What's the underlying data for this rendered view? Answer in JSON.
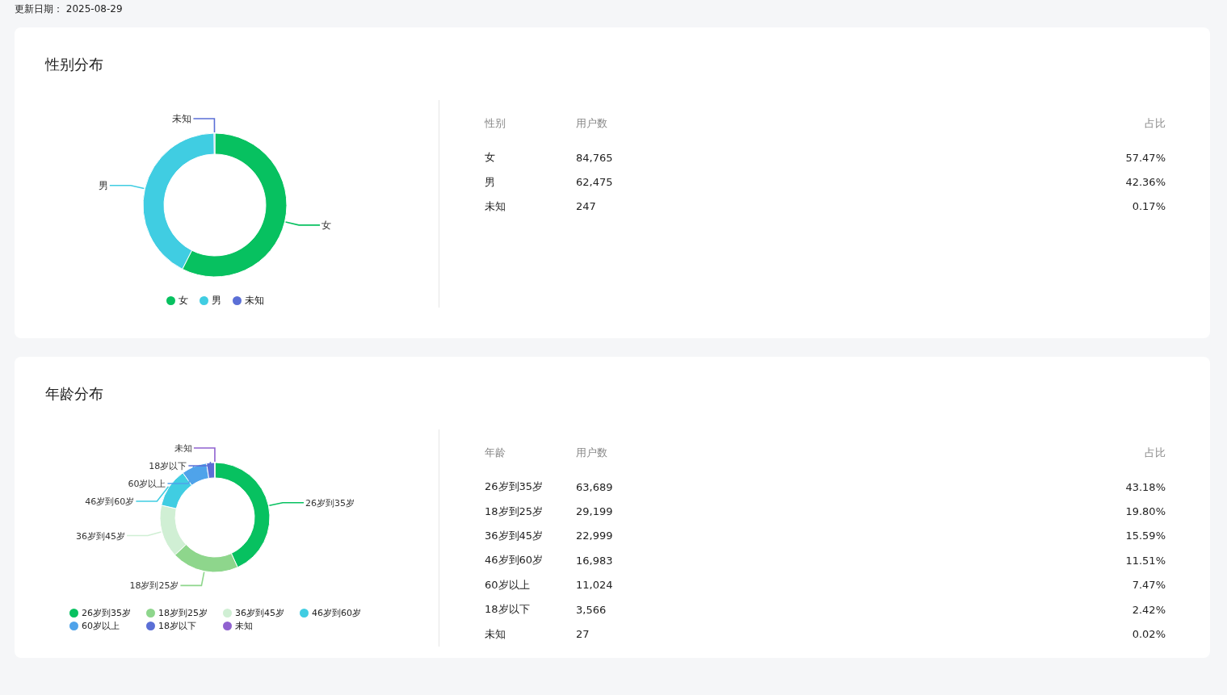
{
  "updated": "更新日期： 2025-08-29",
  "sections": [
    {
      "title": "性别分布",
      "kind": "center",
      "chart_data": {
        "type": "donut",
        "categories": [
          "女",
          "男",
          "未知"
        ],
        "values": [
          57.47,
          42.36,
          0.17
        ],
        "colors": [
          "#07c160",
          "#40cde2",
          "#5b6fd6"
        ]
      },
      "legend": [
        {
          "label": "女",
          "color": "#07c160"
        },
        {
          "label": "男",
          "color": "#40cde2"
        },
        {
          "label": "未知",
          "color": "#5b6fd6"
        }
      ],
      "table": {
        "columns": [
          "性别",
          "用户数",
          "占比"
        ],
        "rows": [
          [
            "女",
            "84,765",
            "57.47%"
          ],
          [
            "男",
            "62,475",
            "42.36%"
          ],
          [
            "未知",
            "247",
            "0.17%"
          ]
        ]
      }
    },
    {
      "title": "年龄分布",
      "kind": "grid",
      "chart_data": {
        "type": "donut",
        "categories": [
          "26岁到35岁",
          "18岁到25岁",
          "36岁到45岁",
          "46岁到60岁",
          "60岁以上",
          "18岁以下",
          "未知"
        ],
        "values": [
          43.18,
          19.8,
          15.59,
          11.51,
          7.47,
          2.42,
          0.02
        ],
        "colors": [
          "#07c160",
          "#8ed68c",
          "#d0efd4",
          "#40cde2",
          "#4fa3ea",
          "#5b6fd6",
          "#9062d0"
        ]
      },
      "legend": [
        {
          "label": "26岁到35岁",
          "color": "#07c160"
        },
        {
          "label": "18岁到25岁",
          "color": "#8ed68c"
        },
        {
          "label": "36岁到45岁",
          "color": "#d0efd4"
        },
        {
          "label": "46岁到60岁",
          "color": "#40cde2"
        },
        {
          "label": "60岁以上",
          "color": "#4fa3ea"
        },
        {
          "label": "18岁以下",
          "color": "#5b6fd6"
        },
        {
          "label": "未知",
          "color": "#9062d0"
        }
      ],
      "table": {
        "columns": [
          "年龄",
          "用户数",
          "占比"
        ],
        "rows": [
          [
            "26岁到35岁",
            "63,689",
            "43.18%"
          ],
          [
            "18岁到25岁",
            "29,199",
            "19.80%"
          ],
          [
            "36岁到45岁",
            "22,999",
            "15.59%"
          ],
          [
            "46岁到60岁",
            "16,983",
            "11.51%"
          ],
          [
            "60岁以上",
            "11,024",
            "7.47%"
          ],
          [
            "18岁以下",
            "3,566",
            "2.42%"
          ],
          [
            "未知",
            "27",
            "0.02%"
          ]
        ]
      }
    }
  ]
}
